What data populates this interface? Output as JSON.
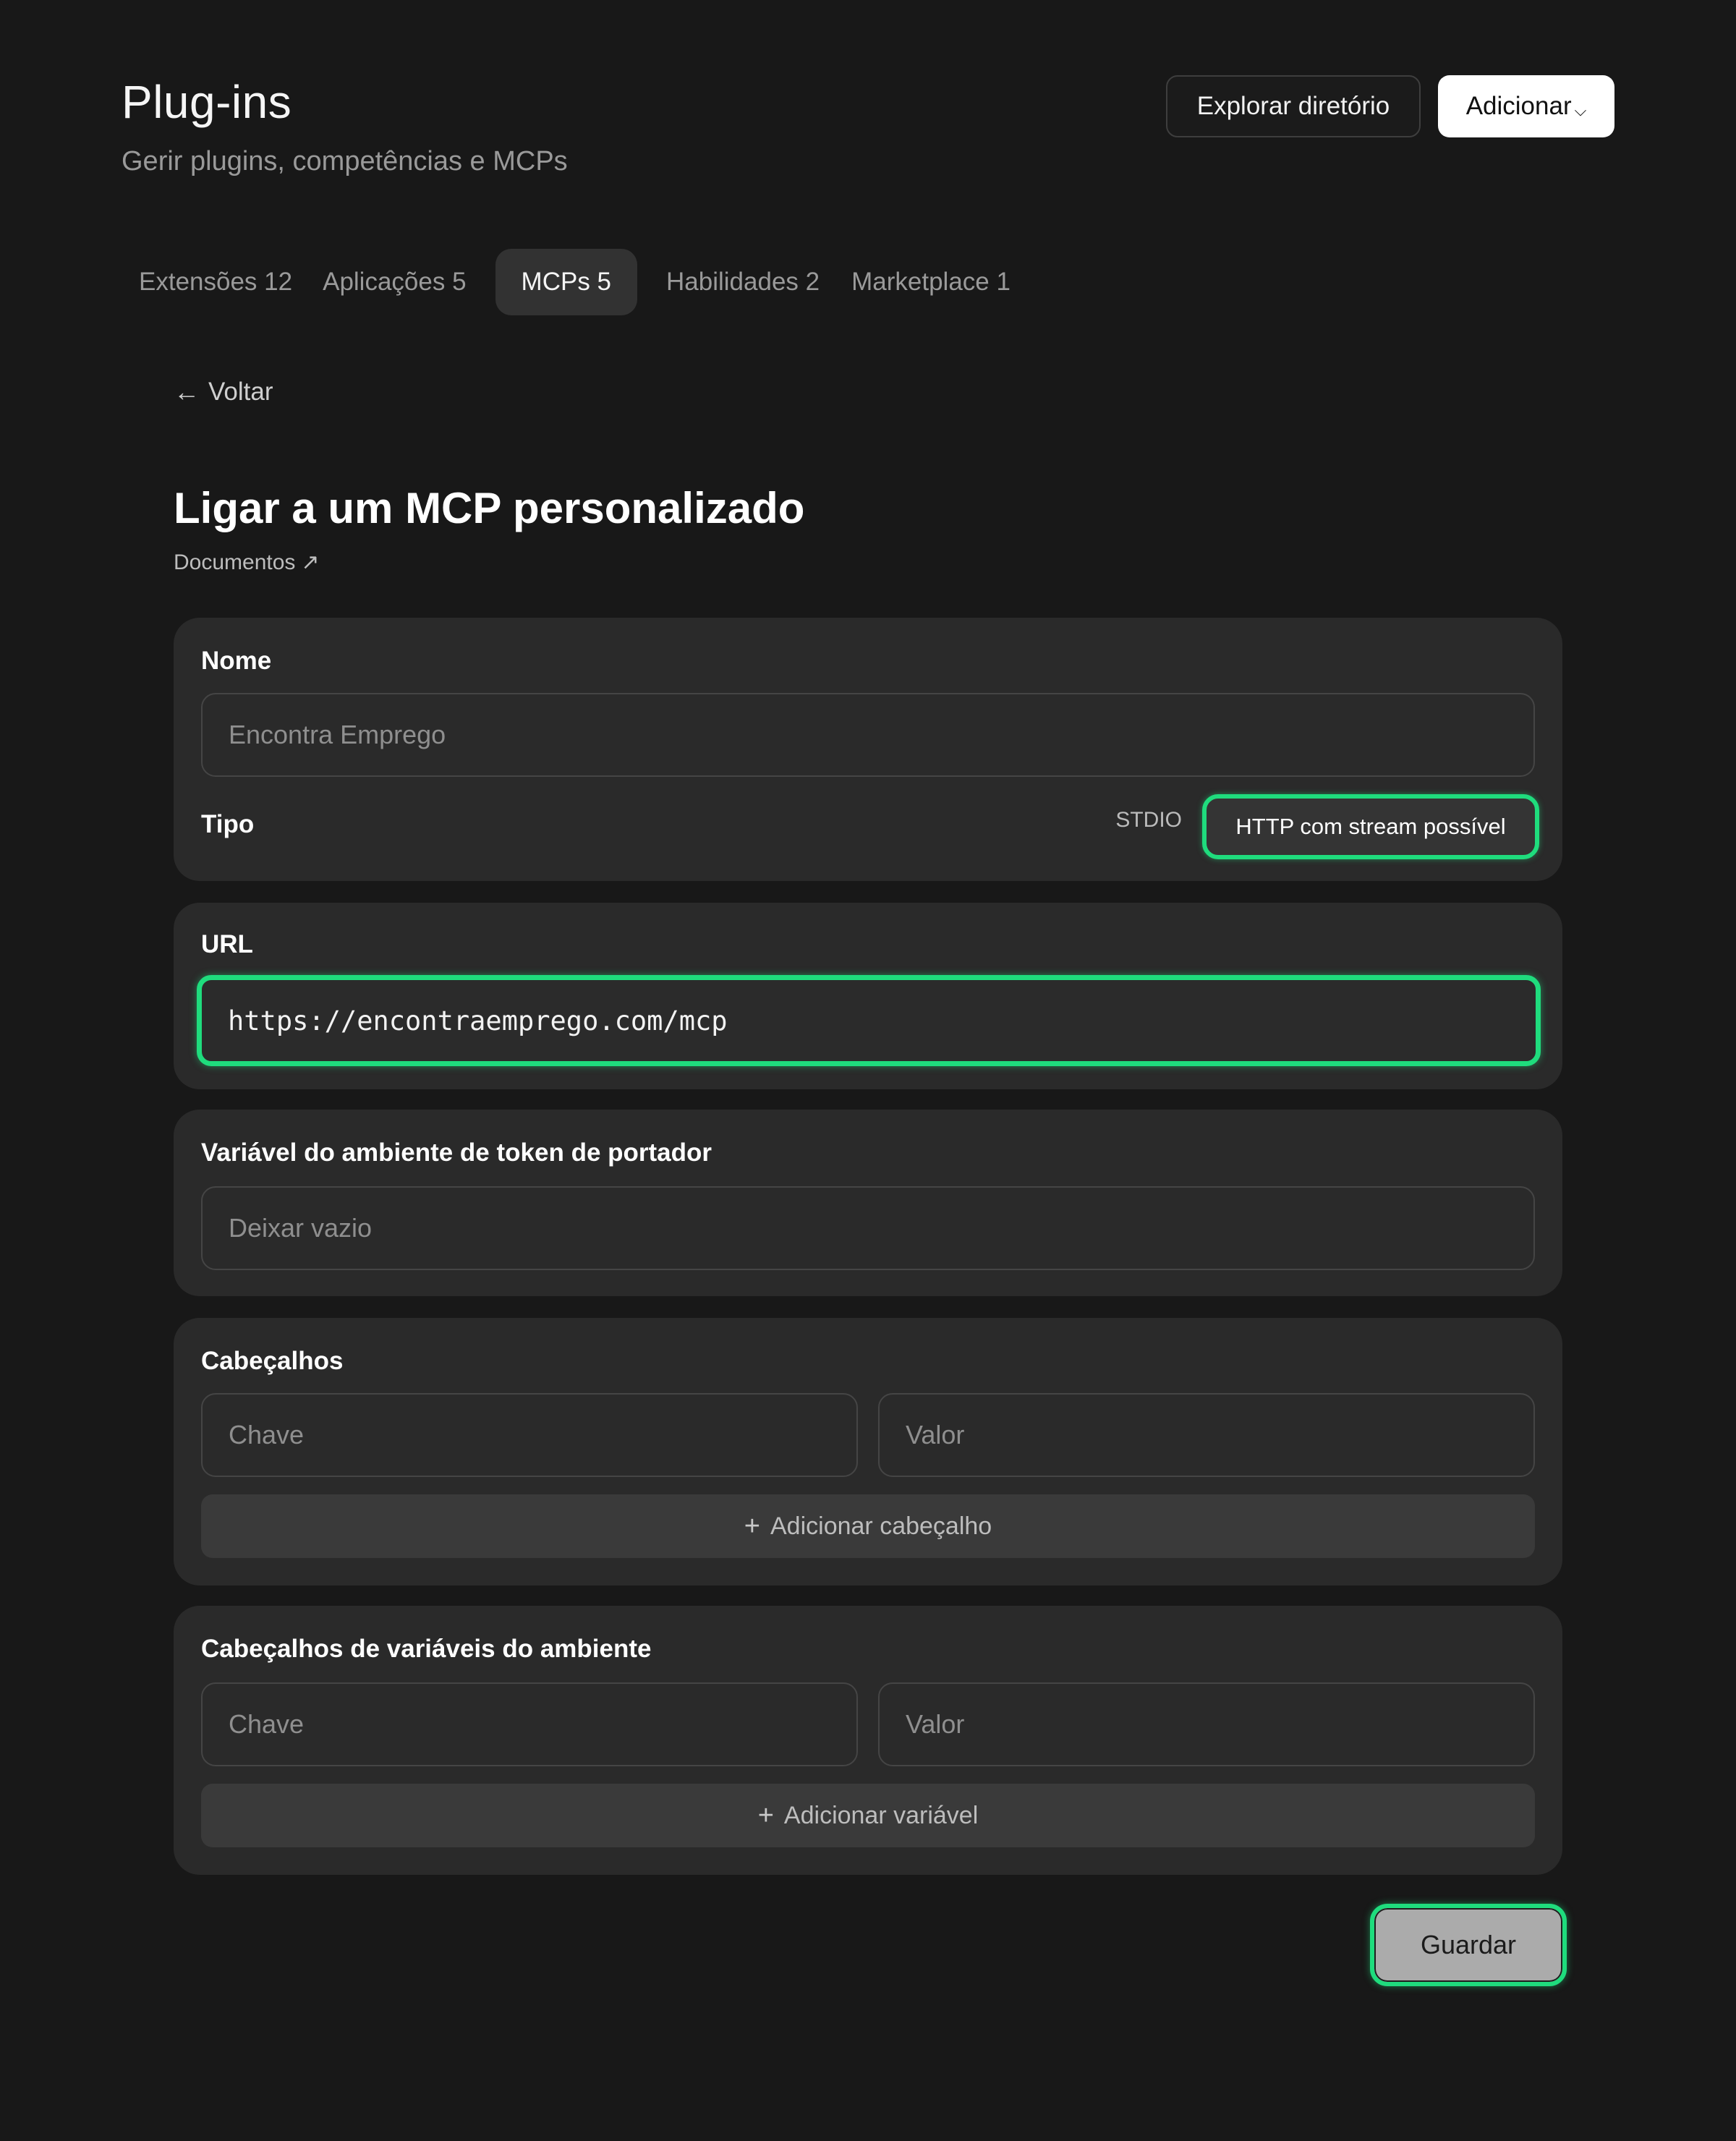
{
  "header": {
    "title": "Plug-ins",
    "subtitle": "Gerir plugins, competências e MCPs",
    "explore_label": "Explorar diretório",
    "add_label": "Adicionar"
  },
  "tabs": [
    {
      "label": "Extensões 12",
      "active": false
    },
    {
      "label": "Aplicações 5",
      "active": false
    },
    {
      "label": "MCPs 5",
      "active": true
    },
    {
      "label": "Habilidades 2",
      "active": false
    },
    {
      "label": "Marketplace 1",
      "active": false
    }
  ],
  "back_label": "Voltar",
  "form": {
    "heading": "Ligar a um MCP personalizado",
    "docs_label": "Documentos",
    "name": {
      "label": "Nome",
      "placeholder": "Encontra Emprego"
    },
    "type": {
      "label": "Tipo",
      "options": [
        "STDIO",
        "HTTP com stream possível"
      ],
      "selected": "HTTP com stream possível"
    },
    "url": {
      "label": "URL",
      "value": "https://encontraemprego.com/mcp"
    },
    "bearer": {
      "label": "Variável do ambiente de token de portador",
      "placeholder": "Deixar vazio"
    },
    "headers": {
      "label": "Cabeçalhos",
      "key_placeholder": "Chave",
      "value_placeholder": "Valor",
      "add_label": "Adicionar cabeçalho"
    },
    "env_headers": {
      "label": "Cabeçalhos de variáveis do ambiente",
      "key_placeholder": "Chave",
      "value_placeholder": "Valor",
      "add_label": "Adicionar variável"
    },
    "save_label": "Guardar"
  },
  "colors": {
    "background": "#181818",
    "card": "#2a2a2a",
    "focus_accent": "#1fdc7d"
  }
}
